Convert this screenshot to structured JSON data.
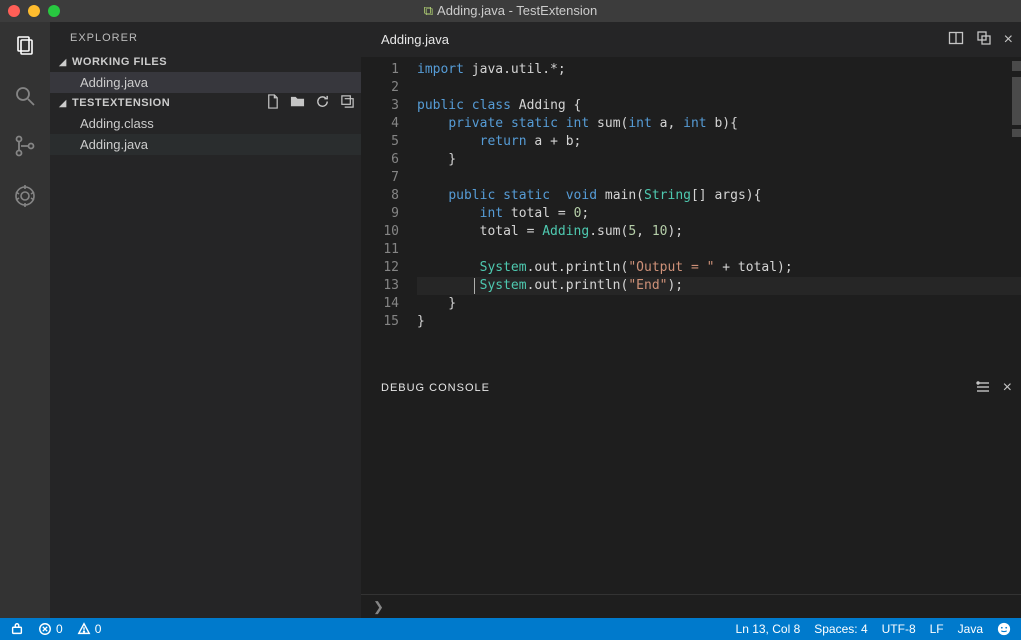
{
  "titlebar": {
    "title": "Adding.java - TestExtension"
  },
  "explorer": {
    "title": "EXPLORER",
    "sections": {
      "working": {
        "label": "WORKING FILES",
        "items": [
          "Adding.java"
        ]
      },
      "project": {
        "label": "TESTEXTENSION",
        "items": [
          "Adding.class",
          "Adding.java"
        ]
      }
    }
  },
  "editor": {
    "tab": "Adding.java",
    "lines": [
      {
        "n": 1,
        "tokens": [
          [
            "k",
            "import"
          ],
          [
            "p",
            " java.util.*;"
          ]
        ]
      },
      {
        "n": 2,
        "tokens": [
          [
            "p",
            ""
          ]
        ]
      },
      {
        "n": 3,
        "tokens": [
          [
            "k",
            "public"
          ],
          [
            "p",
            " "
          ],
          [
            "k",
            "class"
          ],
          [
            "p",
            " Adding {"
          ]
        ]
      },
      {
        "n": 4,
        "tokens": [
          [
            "p",
            "    "
          ],
          [
            "k",
            "private"
          ],
          [
            "p",
            " "
          ],
          [
            "k",
            "static"
          ],
          [
            "p",
            " "
          ],
          [
            "k",
            "int"
          ],
          [
            "p",
            " sum("
          ],
          [
            "k",
            "int"
          ],
          [
            "p",
            " a, "
          ],
          [
            "k",
            "int"
          ],
          [
            "p",
            " b){"
          ]
        ]
      },
      {
        "n": 5,
        "tokens": [
          [
            "p",
            "        "
          ],
          [
            "k",
            "return"
          ],
          [
            "p",
            " a + b;"
          ]
        ]
      },
      {
        "n": 6,
        "tokens": [
          [
            "p",
            "    }"
          ]
        ]
      },
      {
        "n": 7,
        "tokens": [
          [
            "p",
            ""
          ]
        ]
      },
      {
        "n": 8,
        "tokens": [
          [
            "p",
            "    "
          ],
          [
            "k",
            "public"
          ],
          [
            "p",
            " "
          ],
          [
            "k",
            "static"
          ],
          [
            "p",
            "  "
          ],
          [
            "k",
            "void"
          ],
          [
            "p",
            " main("
          ],
          [
            "ty",
            "String"
          ],
          [
            "p",
            "[] args){"
          ]
        ]
      },
      {
        "n": 9,
        "tokens": [
          [
            "p",
            "        "
          ],
          [
            "k",
            "int"
          ],
          [
            "p",
            " total = "
          ],
          [
            "n",
            "0"
          ],
          [
            "p",
            ";"
          ]
        ]
      },
      {
        "n": 10,
        "tokens": [
          [
            "p",
            "        total = "
          ],
          [
            "ty",
            "Adding"
          ],
          [
            "p",
            ".sum("
          ],
          [
            "n",
            "5"
          ],
          [
            "p",
            ", "
          ],
          [
            "n",
            "10"
          ],
          [
            "p",
            ");"
          ]
        ]
      },
      {
        "n": 11,
        "tokens": [
          [
            "p",
            ""
          ]
        ]
      },
      {
        "n": 12,
        "tokens": [
          [
            "p",
            "        "
          ],
          [
            "ty",
            "System"
          ],
          [
            "p",
            ".out.println("
          ],
          [
            "s",
            "\"Output = \""
          ],
          [
            "p",
            " + total);"
          ]
        ]
      },
      {
        "n": 13,
        "tokens": [
          [
            "p",
            "        "
          ],
          [
            "ty",
            "System"
          ],
          [
            "p",
            ".out.println("
          ],
          [
            "s",
            "\"End\""
          ],
          [
            "p",
            ");"
          ]
        ],
        "hl": true,
        "cursor": true
      },
      {
        "n": 14,
        "tokens": [
          [
            "p",
            "    }"
          ]
        ]
      },
      {
        "n": 15,
        "tokens": [
          [
            "p",
            "}"
          ]
        ]
      }
    ]
  },
  "panel": {
    "title": "DEBUG CONSOLE"
  },
  "statusbar": {
    "errors": "0",
    "warnings": "0",
    "ln_col": "Ln 13, Col 8",
    "spaces": "Spaces: 4",
    "encoding": "UTF-8",
    "eol": "LF",
    "language": "Java"
  }
}
